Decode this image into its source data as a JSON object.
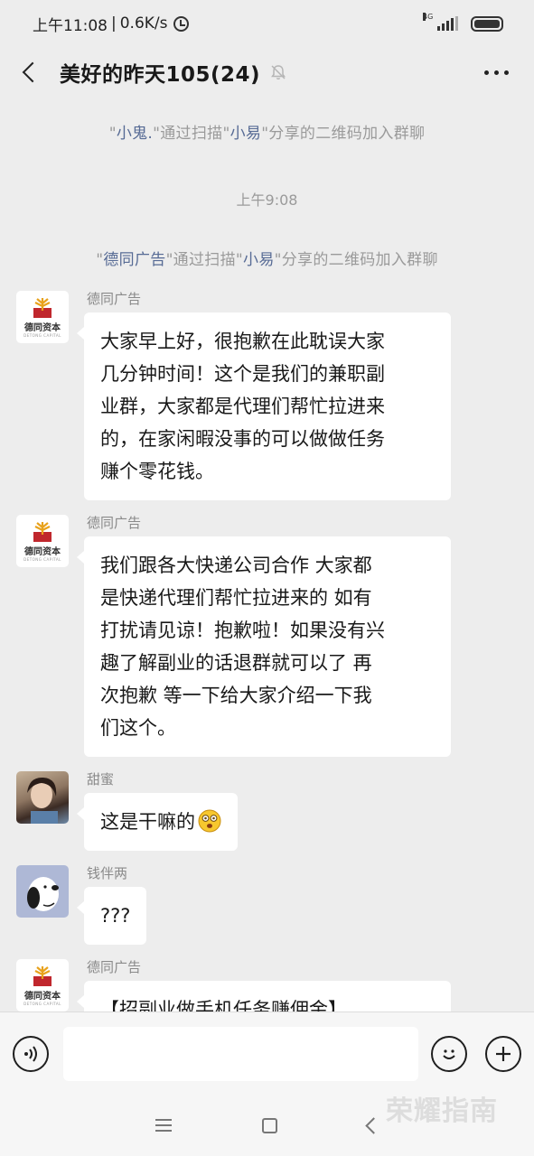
{
  "status_bar": {
    "time": "上午11:08",
    "speed": "0.6K/s",
    "network": "4G"
  },
  "header": {
    "title": "美好的昨天105(24)"
  },
  "notices": [
    {
      "prefix": "\"",
      "name": "小鬼.",
      "mid": "\"通过扫描\"",
      "name2": "小易",
      "suffix": "\"分享的二维码加入群聊"
    },
    {
      "prefix": "\"",
      "name": "德同广告",
      "mid": "\"通过扫描\"",
      "name2": "小易",
      "suffix": "\"分享的二维码加入群聊"
    }
  ],
  "timestamp": "上午9:08",
  "messages": [
    {
      "sender": "德同广告",
      "avatar": "company-logo-avatar",
      "avatar_text": "德同资本",
      "avatar_sub": "DETONG CAPITAL",
      "lines": [
        "大家早上好，很抱歉在此耽误大家",
        "几分钟时间！这个是我们的兼职副",
        "业群，大家都是代理们帮忙拉进来",
        "的，在家闲暇没事的可以做做任务",
        "赚个零花钱。"
      ]
    },
    {
      "sender": "德同广告",
      "avatar": "company-logo-avatar",
      "avatar_text": "德同资本",
      "avatar_sub": "DETONG CAPITAL",
      "lines": [
        "我们跟各大快递公司合作 大家都",
        "是快递代理们帮忙拉进来的 如有",
        "打扰请见谅！抱歉啦！如果没有兴",
        "趣了解副业的话退群就可以了 再",
        "次抱歉 等一下给大家介绍一下我",
        "们这个。"
      ]
    },
    {
      "sender": "甜蜜",
      "avatar": "girl-photo-avatar",
      "text": "这是干嘛的",
      "emoji": "dizzy-face-emoji"
    },
    {
      "sender": "钱伴两",
      "avatar": "snoopy-avatar",
      "text": "???"
    },
    {
      "sender": "德同广告",
      "avatar": "company-logo-avatar",
      "avatar_text": "德同资本",
      "avatar_sub": "DETONG CAPITAL",
      "text": "【招副业做手机任务赚佣金】"
    }
  ],
  "watermark": "荣耀指南",
  "colors": {
    "background": "#ededed",
    "bubble": "#ffffff",
    "link_name": "#576b95",
    "system_text": "#9a9a9a"
  }
}
